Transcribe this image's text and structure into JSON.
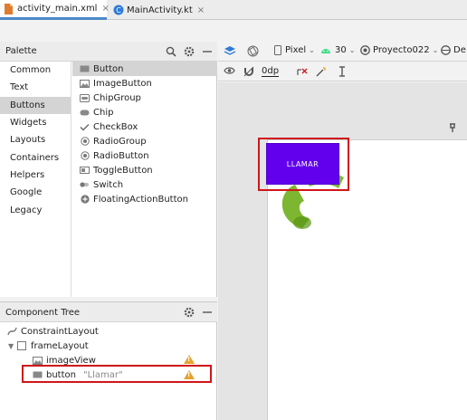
{
  "tabs": [
    {
      "label": "activity_main.xml",
      "active": true,
      "icon": "xml-file-icon"
    },
    {
      "label": "MainActivity.kt",
      "active": false,
      "icon": "kotlin-class-icon"
    }
  ],
  "close_glyph": "×",
  "palette": {
    "title": "Palette",
    "categories": [
      "Common",
      "Text",
      "Buttons",
      "Widgets",
      "Layouts",
      "Containers",
      "Helpers",
      "Google",
      "Legacy"
    ],
    "selected_category": "Buttons",
    "widgets": [
      "Button",
      "ImageButton",
      "ChipGroup",
      "Chip",
      "CheckBox",
      "RadioGroup",
      "RadioButton",
      "ToggleButton",
      "Switch",
      "FloatingActionButton"
    ],
    "selected_widget": "Button"
  },
  "component_tree": {
    "title": "Component Tree",
    "nodes": [
      {
        "label": "ConstraintLayout",
        "detail": ""
      },
      {
        "label": "frameLayout",
        "detail": ""
      },
      {
        "label": "imageView",
        "detail": ""
      },
      {
        "label": "button",
        "detail": "\"Llamar\""
      }
    ]
  },
  "design_toolbar": {
    "device": "Pixel",
    "api": "30",
    "theme": "Proyecto022",
    "locale": "De",
    "margin": "0dp"
  },
  "canvas": {
    "button_label": "LLAMAR"
  },
  "colors": {
    "accent_button": "#6200ee",
    "highlight_box": "#d0161b",
    "warning": "#e6a32c",
    "phone_icon": "#6fae1a"
  }
}
